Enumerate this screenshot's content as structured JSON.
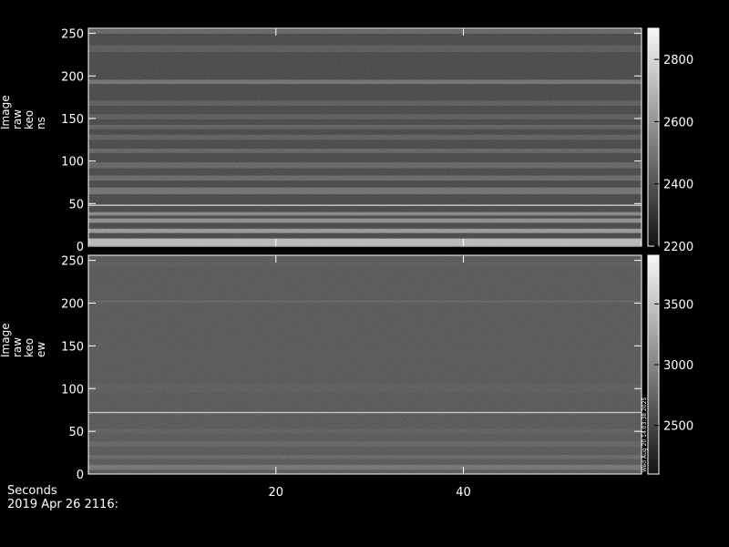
{
  "chart_data": [
    {
      "type": "heatmap",
      "id": "ns",
      "ylabel_lines": [
        "Image",
        "raw",
        "keo",
        "ns"
      ],
      "xlim": [
        0,
        59
      ],
      "ylim": [
        0,
        256
      ],
      "yticks": [
        0,
        50,
        100,
        150,
        200,
        250
      ],
      "xticks": [
        20,
        40
      ],
      "show_xtick_labels": false,
      "colorbar": {
        "range": [
          2200,
          2900
        ],
        "ticks": [
          2200,
          2400,
          2600,
          2800
        ]
      },
      "bands": [
        {
          "center": 5,
          "width": 8,
          "value": 2850
        },
        {
          "center": 18,
          "width": 5,
          "value": 2700
        },
        {
          "center": 30,
          "width": 5,
          "value": 2650
        },
        {
          "center": 38,
          "width": 4,
          "value": 2620
        },
        {
          "center": 48,
          "width": 1.5,
          "value": 2780
        },
        {
          "center": 65,
          "width": 8,
          "value": 2520
        },
        {
          "center": 80,
          "width": 6,
          "value": 2480
        },
        {
          "center": 95,
          "width": 7,
          "value": 2460
        },
        {
          "center": 112,
          "width": 5,
          "value": 2470
        },
        {
          "center": 128,
          "width": 6,
          "value": 2440
        },
        {
          "center": 140,
          "width": 5,
          "value": 2450
        },
        {
          "center": 152,
          "width": 6,
          "value": 2420
        },
        {
          "center": 168,
          "width": 6,
          "value": 2430
        },
        {
          "center": 193,
          "width": 5,
          "value": 2520
        },
        {
          "center": 232,
          "width": 8,
          "value": 2410
        },
        {
          "center": 252,
          "width": 5,
          "value": 2470
        }
      ],
      "baseline": 2330
    },
    {
      "type": "heatmap",
      "id": "ew",
      "ylabel_lines": [
        "Image",
        "raw",
        "keo",
        "ew"
      ],
      "xlim": [
        0,
        59
      ],
      "ylim": [
        0,
        256
      ],
      "yticks": [
        0,
        50,
        100,
        150,
        200,
        250
      ],
      "xticks": [
        20,
        40
      ],
      "xtick_labels": [
        "20",
        "40"
      ],
      "show_xtick_labels": true,
      "colorbar": {
        "range": [
          2100,
          3900
        ],
        "ticks": [
          2500,
          3000,
          3500
        ],
        "annotation": "Wed Aug 20 14:03:38 2025"
      },
      "bands": [
        {
          "center": 8,
          "width": 6,
          "value": 2900
        },
        {
          "center": 20,
          "width": 5,
          "value": 2750
        },
        {
          "center": 35,
          "width": 6,
          "value": 2700
        },
        {
          "center": 50,
          "width": 5,
          "value": 2650
        },
        {
          "center": 72,
          "width": 1.5,
          "value": 3500
        },
        {
          "center": 100,
          "width": 10,
          "value": 2620
        },
        {
          "center": 140,
          "width": 8,
          "value": 2580
        },
        {
          "center": 202,
          "width": 1.5,
          "value": 2700
        },
        {
          "center": 245,
          "width": 6,
          "value": 2600
        }
      ],
      "baseline": 2560
    }
  ],
  "footer": {
    "xlabel": "Seconds",
    "date": "2019 Apr 26 2116:"
  }
}
